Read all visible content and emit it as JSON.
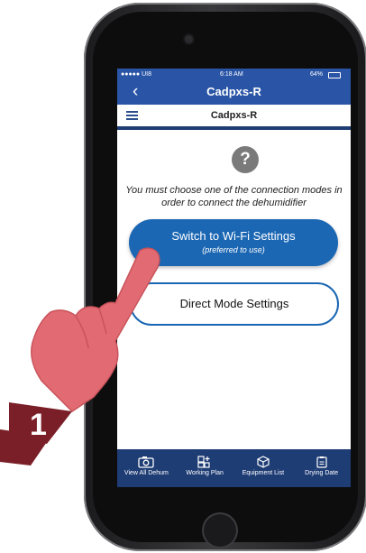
{
  "status_bar": {
    "carrier": "●●●●● UI8",
    "time": "6:18 AM",
    "battery": "64%"
  },
  "nav": {
    "back_icon": "chevron-left-icon",
    "title": "Cadpxs-R"
  },
  "sub_header": {
    "menu_icon": "hamburger-menu-icon",
    "title": "Cadpxs-R"
  },
  "help_icon": "?",
  "message": "You must choose one of the connection modes in order to connect the dehumidifier",
  "buttons": {
    "wifi_label": "Switch to Wi-Fi Settings",
    "wifi_sub": "(preferred to use)",
    "direct_label": "Direct Mode Settings"
  },
  "tabs": [
    {
      "label": "View All Dehum",
      "icon": "camera-icon"
    },
    {
      "label": "Working Plan",
      "icon": "plan-icon"
    },
    {
      "label": "Equipment List",
      "icon": "box-icon"
    },
    {
      "label": "Drying Date",
      "icon": "clipboard-icon"
    }
  ],
  "step_badge": "1",
  "colors": {
    "nav_blue": "#2a55a6",
    "button_blue": "#1b67b3",
    "bottom_bar": "#1f3d75",
    "hand": "#e26b73",
    "badge": "#7a1f27"
  }
}
